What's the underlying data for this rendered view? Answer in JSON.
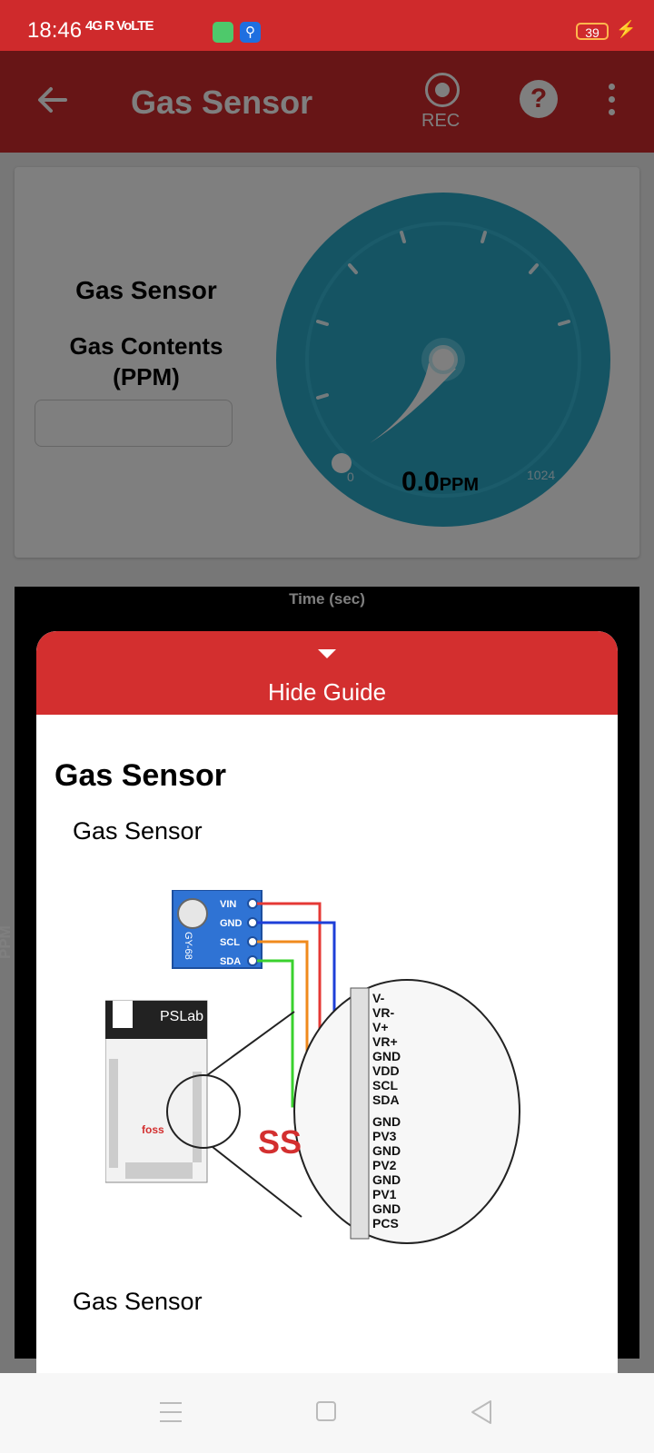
{
  "status_bar": {
    "time": "18:46",
    "network": "4G R VoLTE",
    "battery": "39"
  },
  "app_bar": {
    "title": "Gas Sensor",
    "rec_label": "REC",
    "help_label": "?"
  },
  "sensor_card": {
    "title": "Gas Sensor",
    "subtitle": "Gas Contents (PPM)",
    "value_field": ""
  },
  "gauge": {
    "min_label": "0",
    "max_label": "1024",
    "value": "0.0",
    "unit": "PPM",
    "color": "#2aa8c7"
  },
  "graph": {
    "xlabel": "Time (sec)",
    "ylabel": "PPM"
  },
  "guide": {
    "header_label": "Hide Guide",
    "title": "Gas Sensor",
    "description": "Gas Sensor",
    "description_2": "Gas Sensor",
    "diagram": {
      "module_pins": [
        "VIN",
        "GND",
        "SCL",
        "SDA"
      ],
      "module_name": "GY-68",
      "board_name": "PSLab",
      "header_pins": [
        "V-",
        "VR-",
        "V+",
        "VR+",
        "GND",
        "VDD",
        "SCL",
        "SDA",
        "GND",
        "PV3",
        "GND",
        "PV2",
        "GND",
        "PV1",
        "GND",
        "PCS"
      ],
      "wire_colors": [
        "#e53935",
        "#1e3fd8",
        "#f08a1c",
        "#3ad12e"
      ]
    }
  },
  "colors": {
    "primary": "#cf2a2c",
    "sheet_header": "#d32f2f"
  }
}
